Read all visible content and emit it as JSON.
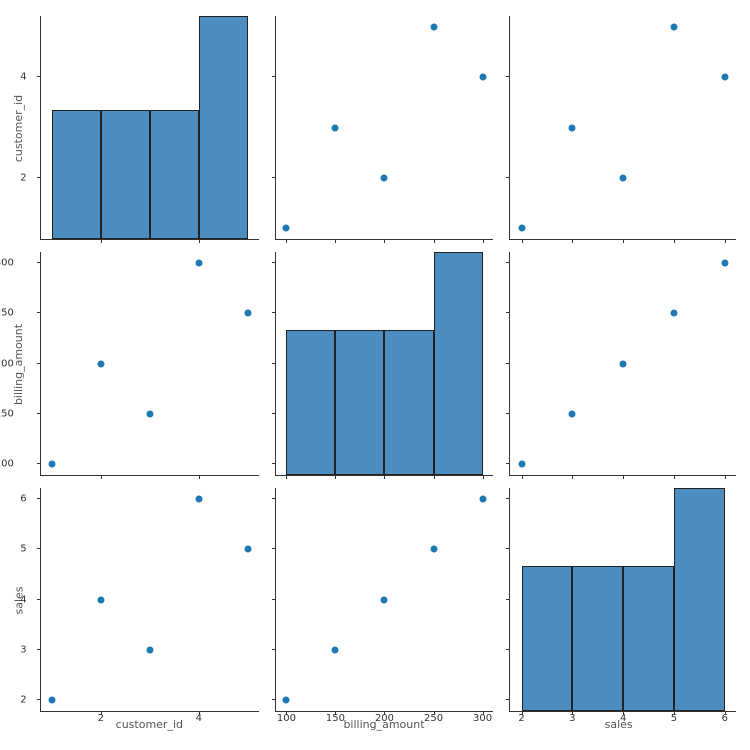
{
  "vars": {
    "customer_id": {
      "label": "customer_id",
      "ticks": [
        2,
        4
      ],
      "range": [
        0.78,
        5.22
      ]
    },
    "billing_amount": {
      "label": "billing_amount",
      "ticks": [
        100,
        150,
        200,
        250,
        300
      ],
      "range": [
        89,
        311
      ]
    },
    "sales": {
      "label": "sales",
      "ticks": [
        2,
        3,
        4,
        5,
        6
      ],
      "range": [
        1.78,
        6.22
      ]
    }
  },
  "data": {
    "customer_id": [
      1,
      2,
      3,
      4,
      5
    ],
    "billing_amount": [
      100,
      200,
      150,
      300,
      250
    ],
    "sales": [
      2,
      4,
      3,
      6,
      5
    ]
  },
  "hist": {
    "customer_id": {
      "edges": [
        1,
        2,
        3,
        4,
        5
      ],
      "heights": [
        0.58,
        0.58,
        0.58,
        1.0
      ]
    },
    "billing_amount": {
      "edges": [
        100,
        150,
        200,
        250,
        300
      ],
      "heights": [
        0.65,
        0.65,
        0.65,
        1.0
      ]
    },
    "sales": {
      "edges": [
        2,
        3,
        4,
        5,
        6
      ],
      "heights": [
        0.65,
        0.65,
        0.65,
        1.0
      ]
    }
  },
  "chart_data": {
    "type": "pairplot",
    "variables": [
      "customer_id",
      "billing_amount",
      "sales"
    ],
    "records": [
      {
        "customer_id": 1,
        "billing_amount": 100,
        "sales": 2
      },
      {
        "customer_id": 2,
        "billing_amount": 200,
        "sales": 4
      },
      {
        "customer_id": 3,
        "billing_amount": 150,
        "sales": 3
      },
      {
        "customer_id": 4,
        "billing_amount": 300,
        "sales": 6
      },
      {
        "customer_id": 5,
        "billing_amount": 250,
        "sales": 5
      }
    ],
    "diagonal": "hist",
    "color": "#4c8cbf"
  }
}
